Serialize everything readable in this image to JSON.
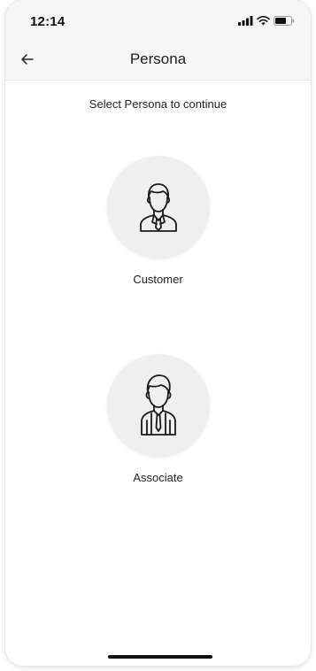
{
  "status_bar": {
    "time": "12:14",
    "icons": [
      "signal-icon",
      "wifi-icon",
      "battery-icon"
    ]
  },
  "header": {
    "title": "Persona",
    "back_icon": "arrow-left-icon"
  },
  "main": {
    "subtitle": "Select Persona to continue",
    "personas": [
      {
        "label": "Customer",
        "icon": "customer-person-icon"
      },
      {
        "label": "Associate",
        "icon": "associate-person-icon"
      }
    ]
  },
  "colors": {
    "background": "#ffffff",
    "bar_background": "#f6f6f6",
    "circle_background": "#efefef",
    "text": "#222222"
  }
}
